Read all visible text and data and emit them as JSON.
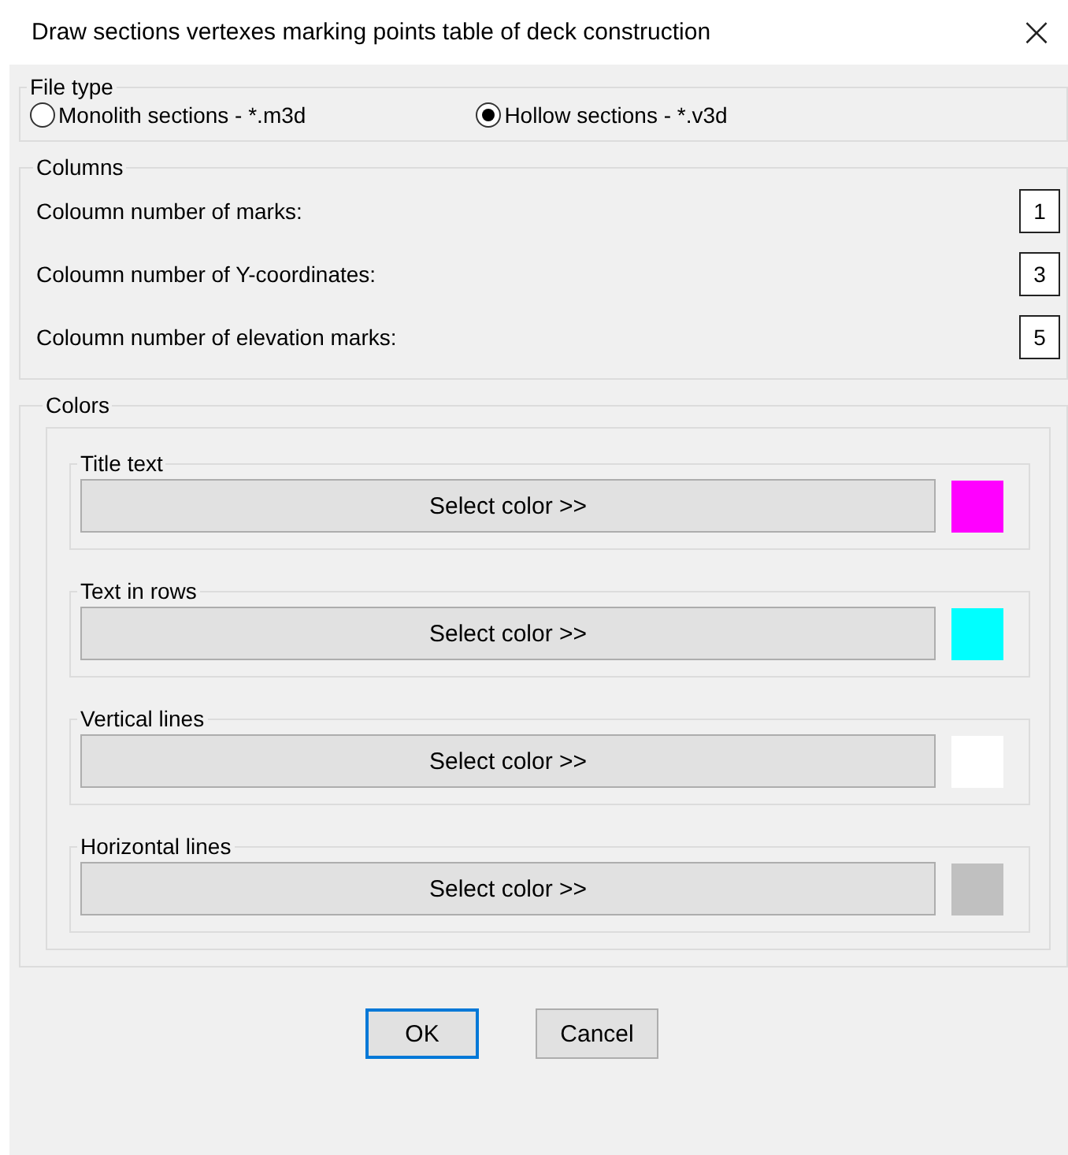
{
  "window": {
    "title": "Draw sections vertexes marking points table of deck construction",
    "close": "×"
  },
  "file_type": {
    "legend": "File type",
    "options": [
      {
        "label": "Monolith sections - *.m3d",
        "selected": false
      },
      {
        "label": "Hollow sections - *.v3d",
        "selected": true
      }
    ]
  },
  "columns": {
    "legend": "Columns",
    "fields": [
      {
        "label": "Coloumn number of marks:",
        "value": "1"
      },
      {
        "label": "Coloumn number of Y-coordinates:",
        "value": "3"
      },
      {
        "label": "Coloumn number of elevation marks:",
        "value": "5"
      }
    ]
  },
  "colors": {
    "legend": "Colors",
    "items": [
      {
        "legend": "Title text",
        "button": "Select color >>",
        "color": "#ff00ff"
      },
      {
        "legend": "Text in rows",
        "button": "Select color >>",
        "color": "#00ffff"
      },
      {
        "legend": "Vertical lines",
        "button": "Select color >>",
        "color": "#ffffff"
      },
      {
        "legend": "Horizontal lines",
        "button": "Select color >>",
        "color": "#c0c0c0"
      }
    ]
  },
  "buttons": [
    {
      "label": "OK",
      "default": true
    },
    {
      "label": "Cancel",
      "default": false
    }
  ]
}
